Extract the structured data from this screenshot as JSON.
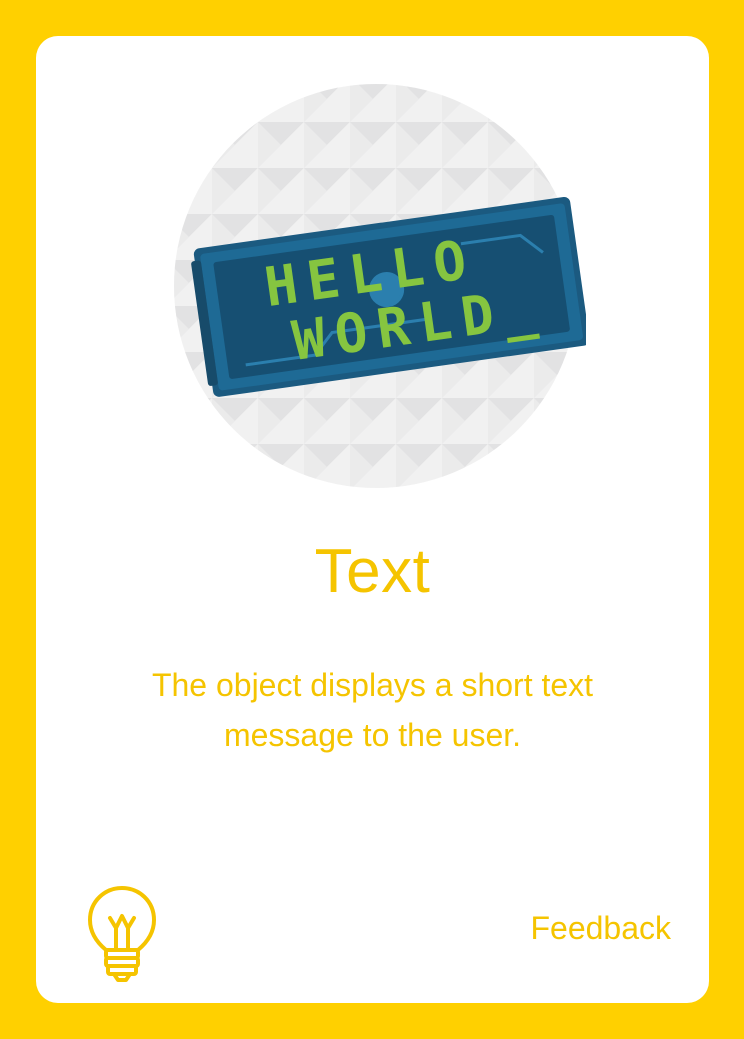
{
  "card": {
    "title": "Text",
    "description": "The object displays a short text message to the user.",
    "feedback_label": "Feedback"
  },
  "illustration": {
    "sign_text_line1": "HELLO",
    "sign_text_line2": "WORLD_",
    "icon": "hello-world-led-sign-icon"
  },
  "icons": {
    "hint": "lightbulb-icon"
  },
  "colors": {
    "background": "#FFD000",
    "card": "#FFFFFF",
    "accent_text": "#F5C400",
    "sign_body": "#1E5F86",
    "led_green": "#8CC63F"
  }
}
